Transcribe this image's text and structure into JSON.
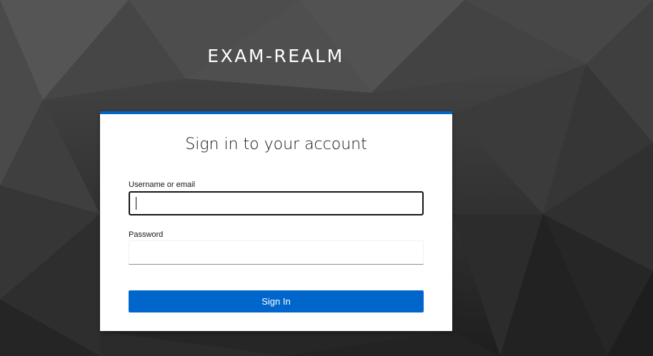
{
  "realm": {
    "title": "EXAM-REALM"
  },
  "login_card": {
    "title": "Sign in to your account",
    "username_label": "Username or email",
    "username_value": "",
    "password_label": "Password",
    "password_value": "",
    "submit_label": "Sign In"
  },
  "colors": {
    "accent": "#0066cc",
    "card_background": "#ffffff",
    "page_background": "#2b2b2b"
  }
}
